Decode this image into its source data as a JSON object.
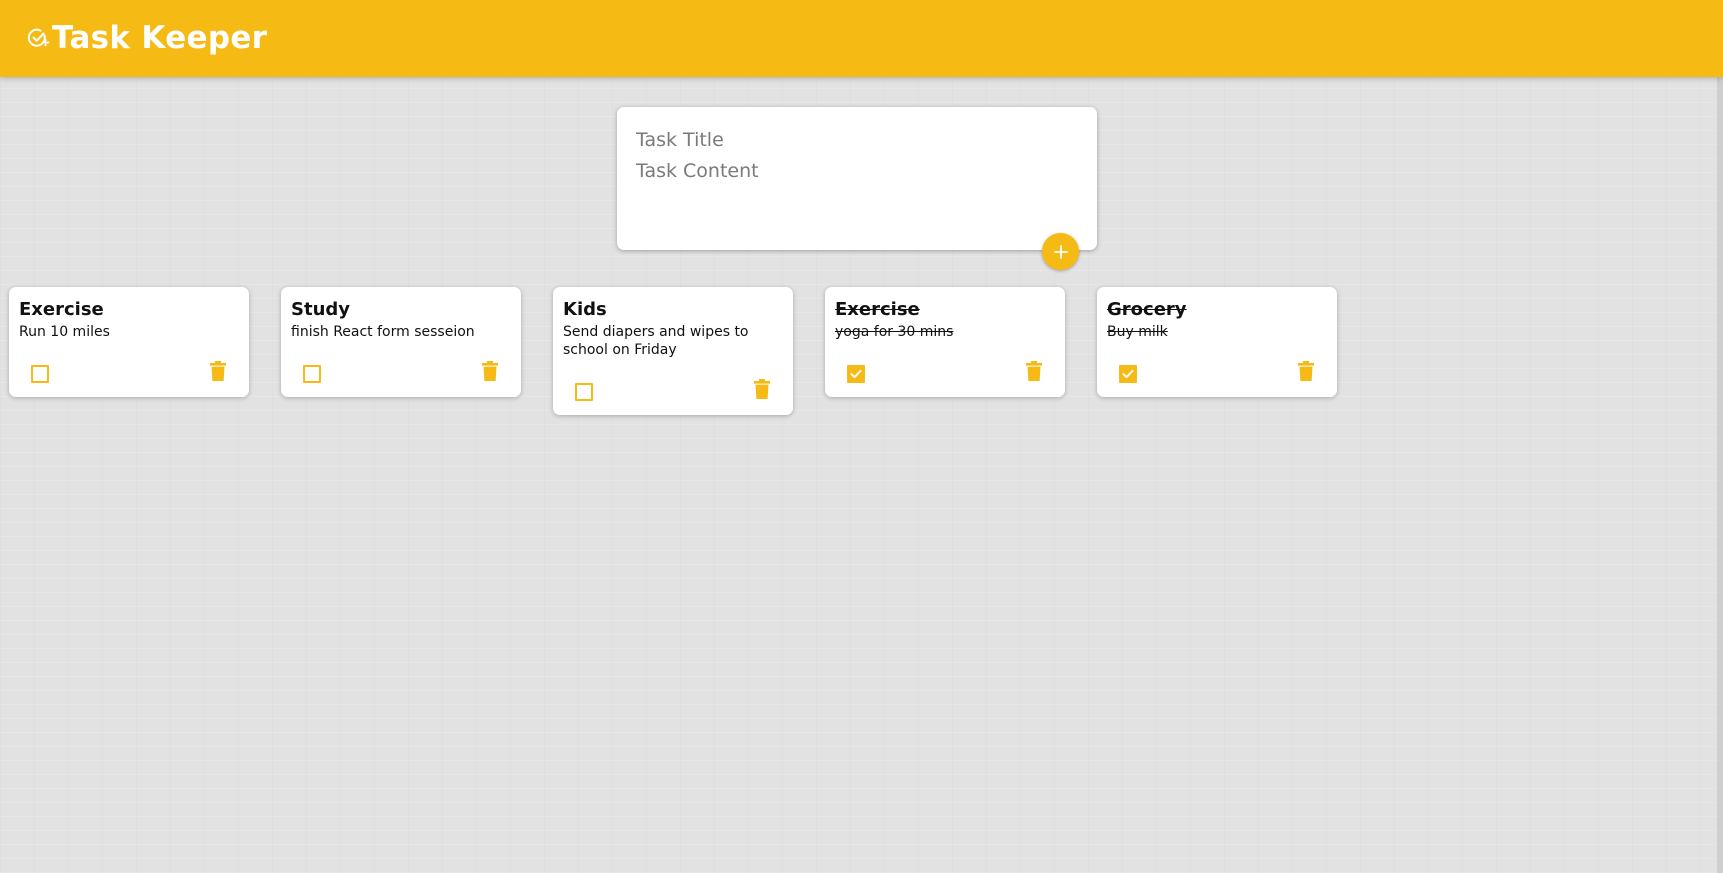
{
  "app": {
    "title": "Task Keeper",
    "accent_color": "#f5ba13",
    "logo_icon": "check-circle-plus-icon"
  },
  "create_form": {
    "title_placeholder": "Task Title",
    "content_placeholder": "Task Content",
    "add_icon": "plus-icon"
  },
  "tasks": [
    {
      "title": "Exercise",
      "content": "Run 10 miles",
      "completed": false
    },
    {
      "title": "Study",
      "content": "finish React form sesseion",
      "completed": false
    },
    {
      "title": "Kids",
      "content": "Send diapers and wipes to school on Friday",
      "completed": false
    },
    {
      "title": "Exercise",
      "content": "yoga for 30 mins",
      "completed": true
    },
    {
      "title": "Grocery",
      "content": "Buy milk",
      "completed": true
    }
  ],
  "task_icons": {
    "checkbox": "checkbox-icon",
    "delete": "trash-icon"
  }
}
